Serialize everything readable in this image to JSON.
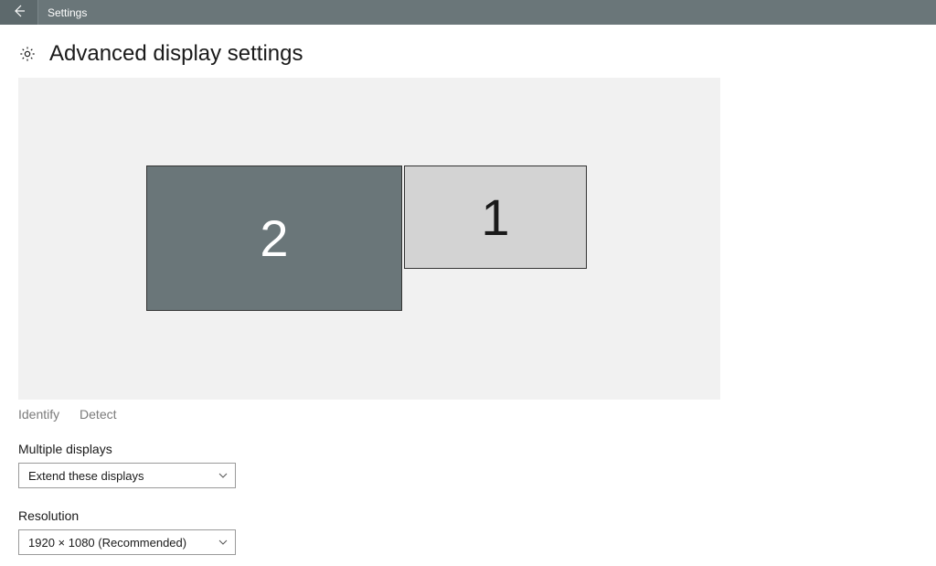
{
  "titlebar": {
    "app_name": "Settings"
  },
  "page": {
    "title": "Advanced display settings"
  },
  "monitors": {
    "m2_label": "2",
    "m1_label": "1"
  },
  "links": {
    "identify": "Identify",
    "detect": "Detect"
  },
  "multiple_displays": {
    "label": "Multiple displays",
    "value": "Extend these displays"
  },
  "resolution": {
    "label": "Resolution",
    "value": "1920 × 1080 (Recommended)"
  }
}
